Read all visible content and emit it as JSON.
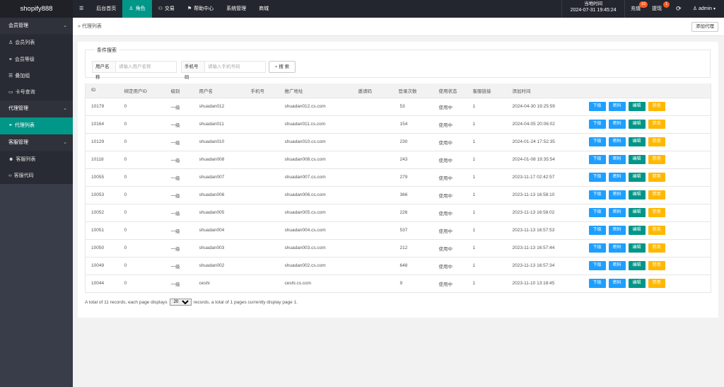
{
  "brand": "shopify888",
  "nav": [
    {
      "icon": "☰",
      "label": ""
    },
    {
      "icon": "",
      "label": "后台首页"
    },
    {
      "icon": "♙",
      "label": "角色"
    },
    {
      "icon": "⚇",
      "label": "交易"
    },
    {
      "icon": "⚑",
      "label": "帮助中心"
    },
    {
      "icon": "",
      "label": "系统管理"
    },
    {
      "icon": "",
      "label": "商城"
    }
  ],
  "topright": {
    "time_label": "当地时间",
    "time_value": "2024-07-31 19:45:24",
    "recharge_label": "充值",
    "recharge_badge": "10",
    "withdraw_label": "提现",
    "withdraw_badge": "1",
    "refresh_icon": "⟳",
    "user_label": "admin"
  },
  "sidebar": {
    "groups": [
      {
        "label": "会员管理",
        "items": [
          {
            "icon": "♙",
            "label": "会员列表"
          },
          {
            "icon": "⚭",
            "label": "会员等级"
          },
          {
            "icon": "☰",
            "label": "叠加组"
          },
          {
            "icon": "▭",
            "label": "卡号查询"
          }
        ]
      },
      {
        "label": "代理管理",
        "items": [
          {
            "icon": "⚭",
            "label": "代理列表"
          }
        ]
      },
      {
        "label": "客服管理",
        "items": [
          {
            "icon": "☻",
            "label": "客服列表"
          },
          {
            "icon": "‹›",
            "label": "客服代码"
          }
        ]
      }
    ]
  },
  "breadcrumb": "» 代理列表",
  "add_button": "添加代理",
  "search": {
    "legend": "条件搜索",
    "username_label": "用户名称",
    "username_placeholder": "请输入用户名称",
    "phone_label": "手机号码",
    "phone_placeholder": "请输入手机号码",
    "button": "搜 索"
  },
  "table": {
    "headers": [
      "ID",
      "绑定用户ID",
      "级别",
      "用户名",
      "手机号",
      "推广地址",
      "邀请码",
      "登录次数",
      "使用状态",
      "客服链接",
      "添加时间",
      ""
    ],
    "ops": [
      "下级",
      "密码",
      "编辑",
      "禁用"
    ],
    "rows": [
      {
        "id": "10179",
        "bind": "0",
        "level": "一级",
        "user": "shuadan012",
        "phone": "",
        "url": "shuadan012.cs.com",
        "code": "",
        "logins": "53",
        "status": "使用中",
        "cs": "1",
        "time": "2024-04-30 19:25:59"
      },
      {
        "id": "10164",
        "bind": "0",
        "level": "一级",
        "user": "shuadan011",
        "phone": "",
        "url": "shuadan011.cs.com",
        "code": "",
        "logins": "154",
        "status": "使用中",
        "cs": "1",
        "time": "2024-04-05 20:06:02"
      },
      {
        "id": "10129",
        "bind": "0",
        "level": "一级",
        "user": "shuadan010",
        "phone": "",
        "url": "shuadan010.cs.com",
        "code": "",
        "logins": "230",
        "status": "使用中",
        "cs": "1",
        "time": "2024-01-24 17:52:35"
      },
      {
        "id": "10118",
        "bind": "0",
        "level": "一级",
        "user": "shuadan008",
        "phone": "",
        "url": "shuadan008.cs.com",
        "code": "",
        "logins": "243",
        "status": "使用中",
        "cs": "1",
        "time": "2024-01-08 19:35:54"
      },
      {
        "id": "10055",
        "bind": "0",
        "level": "一级",
        "user": "shuadan007",
        "phone": "",
        "url": "shuadan007.cs.com",
        "code": "",
        "logins": "279",
        "status": "使用中",
        "cs": "1",
        "time": "2023-11-17 02:42:57"
      },
      {
        "id": "10053",
        "bind": "0",
        "level": "一级",
        "user": "shuadan006",
        "phone": "",
        "url": "shuadan006.cs.com",
        "code": "",
        "logins": "366",
        "status": "使用中",
        "cs": "1",
        "time": "2023-11-13 16:58:10"
      },
      {
        "id": "10052",
        "bind": "0",
        "level": "一级",
        "user": "shuadan005",
        "phone": "",
        "url": "shuadan005.cs.com",
        "code": "",
        "logins": "226",
        "status": "使用中",
        "cs": "1",
        "time": "2023-11-13 16:58:02"
      },
      {
        "id": "10051",
        "bind": "0",
        "level": "一级",
        "user": "shuadan004",
        "phone": "",
        "url": "shuadan004.cs.com",
        "code": "",
        "logins": "537",
        "status": "使用中",
        "cs": "1",
        "time": "2023-11-13 16:57:53"
      },
      {
        "id": "10050",
        "bind": "0",
        "level": "一级",
        "user": "shuadan003",
        "phone": "",
        "url": "shuadan003.cs.com",
        "code": "",
        "logins": "212",
        "status": "使用中",
        "cs": "1",
        "time": "2023-11-13 16:57:44"
      },
      {
        "id": "10049",
        "bind": "0",
        "level": "一级",
        "user": "shuadan002",
        "phone": "",
        "url": "shuadan002.cs.com",
        "code": "",
        "logins": "648",
        "status": "使用中",
        "cs": "1",
        "time": "2023-11-13 16:57:34"
      },
      {
        "id": "10044",
        "bind": "0",
        "level": "一级",
        "user": "ceshi",
        "phone": "",
        "url": "ceshi.cs.com",
        "code": "",
        "logins": "9",
        "status": "使用中",
        "cs": "1",
        "time": "2023-11-10 13:18:45"
      }
    ]
  },
  "pager": {
    "before": "A total of 11 records, each page displays",
    "selected": "20",
    "after": "records, a total of 1 pages currently display page 1."
  },
  "colors": {
    "accent": "#009688",
    "blue": "#1e9fff",
    "yellow": "#ffb800",
    "badge": "#ff5722",
    "topbar": "#23262e",
    "sidebar": "#393d49"
  }
}
